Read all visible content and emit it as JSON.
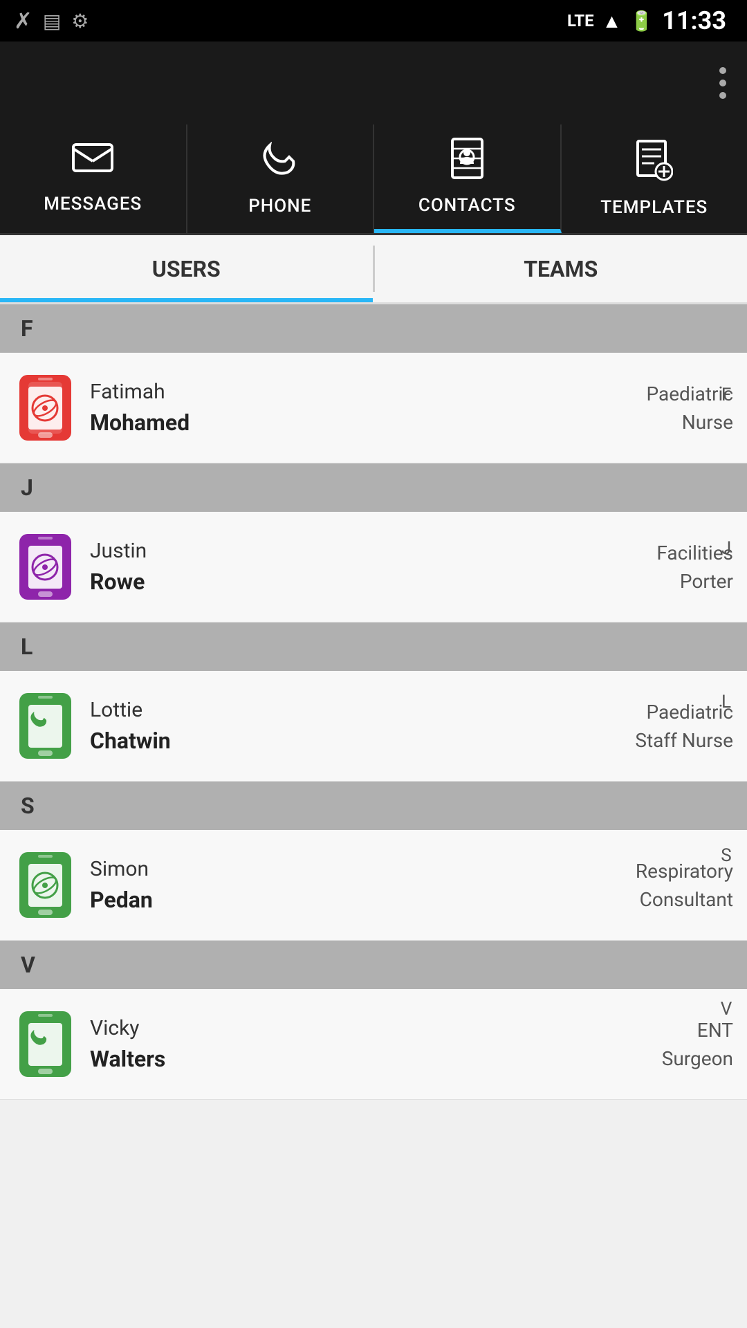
{
  "statusBar": {
    "time": "11:33",
    "icons": [
      "lte-icon",
      "signal-icon",
      "battery-icon"
    ]
  },
  "tabs": [
    {
      "id": "messages",
      "label": "MESSAGES",
      "icon": "✉"
    },
    {
      "id": "phone",
      "label": "PHONE",
      "icon": "📞"
    },
    {
      "id": "contacts",
      "label": "CONTACTS",
      "icon": "📋",
      "active": true
    },
    {
      "id": "templates",
      "label": "TEMPLATES",
      "icon": "📄"
    }
  ],
  "subTabs": [
    {
      "id": "users",
      "label": "USERS",
      "active": true
    },
    {
      "id": "teams",
      "label": "TEAMS",
      "active": false
    }
  ],
  "sections": [
    {
      "letter": "F",
      "contacts": [
        {
          "firstname": "Fatimah",
          "lastname": "Mohamed",
          "department": "Paediatric",
          "role": "Nurse",
          "avatarColor": "red"
        }
      ]
    },
    {
      "letter": "J",
      "contacts": [
        {
          "firstname": "Justin",
          "lastname": "Rowe",
          "department": "Facilities",
          "role": "Porter",
          "avatarColor": "purple"
        }
      ]
    },
    {
      "letter": "L",
      "contacts": [
        {
          "firstname": "Lottie",
          "lastname": "Chatwin",
          "department": "Paediatric",
          "role": "Staff Nurse",
          "avatarColor": "green"
        }
      ]
    },
    {
      "letter": "S",
      "contacts": [
        {
          "firstname": "Simon",
          "lastname": "Pedan",
          "department": "Respiratory",
          "role": "Consultant",
          "avatarColor": "green"
        }
      ]
    },
    {
      "letter": "V",
      "contacts": [
        {
          "firstname": "Vicky",
          "lastname": "Walters",
          "department": "ENT",
          "role": "Surgeon",
          "avatarColor": "green"
        }
      ]
    }
  ],
  "alphabetSidebar": [
    "F",
    "J",
    "L",
    "S",
    "V"
  ],
  "moreMenu": {
    "label": "more-options"
  }
}
